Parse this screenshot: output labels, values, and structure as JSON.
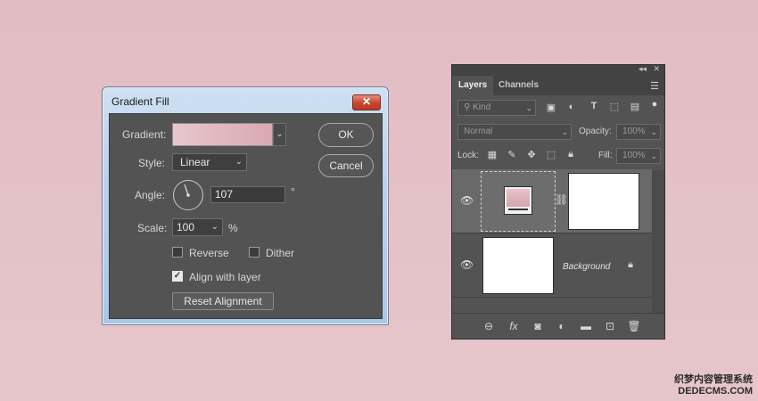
{
  "dialog": {
    "title": "Gradient Fill",
    "close_glyph": "✕",
    "gradient_label": "Gradient:",
    "style_label": "Style:",
    "style_value": "Linear",
    "angle_label": "Angle:",
    "angle_value": "107",
    "angle_unit": "°",
    "scale_label": "Scale:",
    "scale_value": "100",
    "scale_unit": "%",
    "reverse_label": "Reverse",
    "reverse_checked": false,
    "dither_label": "Dither",
    "dither_checked": false,
    "align_label": "Align with layer",
    "align_checked": true,
    "reset_label": "Reset Alignment",
    "ok_label": "OK",
    "cancel_label": "Cancel",
    "gradient_colors": [
      "#e7c7cc",
      "#d9a9b1"
    ]
  },
  "layers_panel": {
    "tabs": [
      "Layers",
      "Channels"
    ],
    "active_tab": "Layers",
    "kind_filter": "Kind",
    "blend_mode": "Normal",
    "opacity_label": "Opacity:",
    "opacity_value": "100%",
    "lock_label": "Lock:",
    "fill_label": "Fill:",
    "fill_value": "100%",
    "layers": [
      {
        "name": "",
        "type": "gradient-fill",
        "visible": true,
        "selected": true
      },
      {
        "name": "Background",
        "type": "background",
        "visible": true,
        "locked": true
      }
    ],
    "footer_icons": [
      "link-icon",
      "fx-icon",
      "mask-icon",
      "adjustment-icon",
      "folder-icon",
      "new-layer-icon",
      "trash-icon"
    ]
  },
  "watermark": {
    "line1": "织梦内容管理系统",
    "line2": "DEDECMS.COM"
  }
}
